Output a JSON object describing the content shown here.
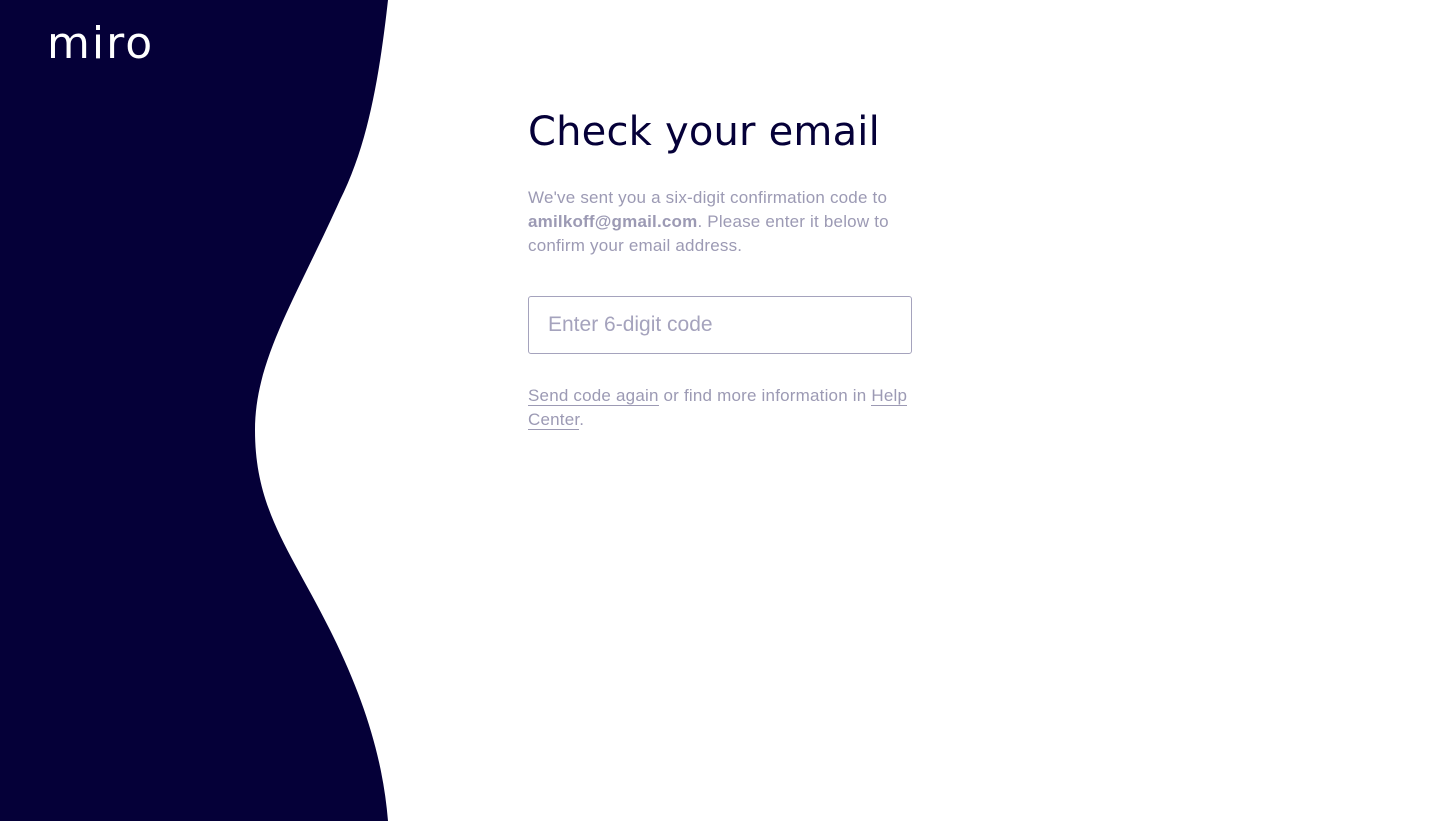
{
  "brand": {
    "logo_text": "miro",
    "primary_color": "#050038",
    "muted_color": "#9c9ab4",
    "border_color": "#a5a3bd"
  },
  "main": {
    "title": "Check your email",
    "description_prefix": "We've sent you a six-digit confirmation code to ",
    "email": "amilkoff@gmail.com",
    "description_suffix": ". Please enter it below to confirm your email address.",
    "code_input": {
      "placeholder": "Enter 6-digit code",
      "value": ""
    },
    "help": {
      "resend_link": "Send code again",
      "middle_text": " or find more information in ",
      "help_center_link": "Help Center",
      "end_text": "."
    }
  }
}
